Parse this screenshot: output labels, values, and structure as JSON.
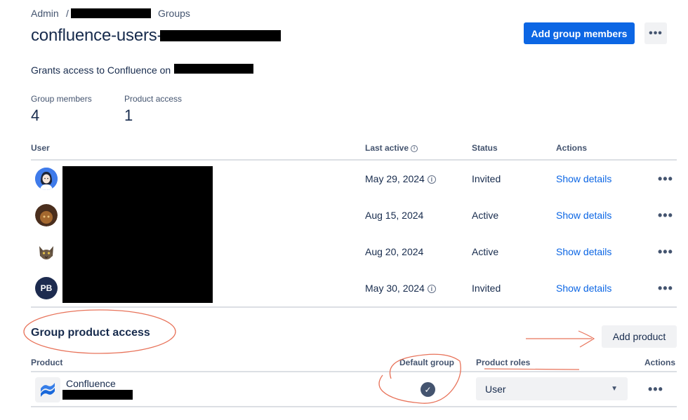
{
  "breadcrumb": {
    "admin": "Admin",
    "separator": "/",
    "groups": "Groups"
  },
  "header": {
    "title": "confluence-users-",
    "add_members_label": "Add group members",
    "more_label": "•••"
  },
  "description": "Grants access to Confluence on",
  "stats": [
    {
      "label": "Group members",
      "value": "4"
    },
    {
      "label": "Product access",
      "value": "1"
    }
  ],
  "members_table": {
    "columns": {
      "user": "User",
      "last_active": "Last active",
      "status": "Status",
      "actions": "Actions"
    },
    "rows": [
      {
        "avatar": "woman-avatar-icon",
        "last_active": "May 29, 2024",
        "info": true,
        "status": "Invited",
        "action": "Show details",
        "more": "•••"
      },
      {
        "avatar": "photo-avatar-icon",
        "last_active": "Aug 15, 2024",
        "info": false,
        "status": "Active",
        "action": "Show details",
        "more": "•••"
      },
      {
        "avatar": "cat-avatar-icon",
        "last_active": "Aug 20, 2024",
        "info": false,
        "status": "Active",
        "action": "Show details",
        "more": "•••"
      },
      {
        "avatar": "initials-avatar",
        "initials": "PB",
        "last_active": "May 30, 2024",
        "info": true,
        "status": "Invited",
        "action": "Show details",
        "more": "•••"
      }
    ]
  },
  "product_access": {
    "title": "Group product access",
    "add_product_label": "Add product",
    "columns": {
      "product": "Product",
      "default_group": "Default group",
      "product_roles": "Product roles",
      "actions": "Actions"
    },
    "rows": [
      {
        "product": "Confluence",
        "icon": "confluence-logo-icon",
        "default_group": true,
        "role": "User",
        "more": "•••"
      }
    ]
  },
  "colors": {
    "primary": "#0c66e4",
    "text": "#172b4d",
    "subtle_text": "#44546f",
    "annotation": "#e8735a",
    "initials_avatar": "#1d2b4f"
  }
}
